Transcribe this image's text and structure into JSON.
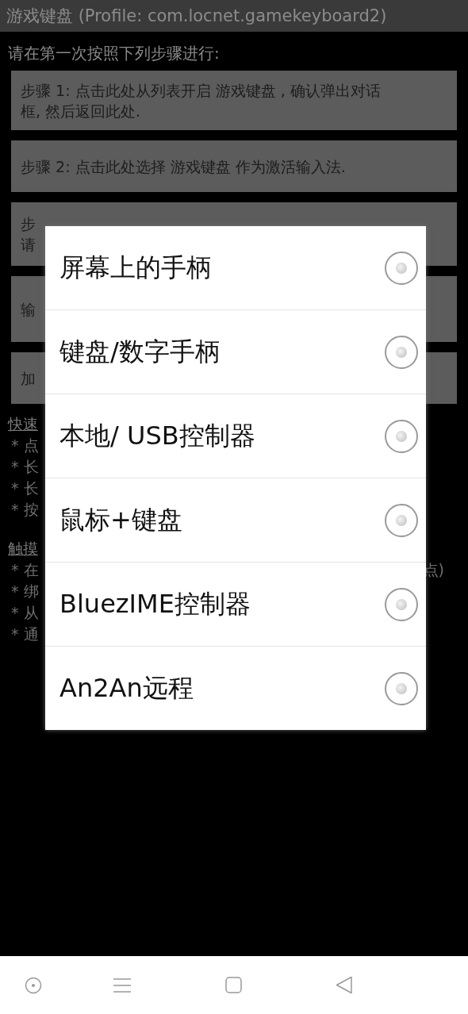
{
  "window": {
    "title": "游戏键盘 (Profile: com.locnet.gamekeyboard2)"
  },
  "intro": "请在第一次按照下列步骤进行:",
  "steps": [
    {
      "lines": [
        "步骤 1: 点击此处从列表开启 游戏键盘 , 确认弹出对话",
        "框, 然后返回此处."
      ]
    },
    {
      "lines": [
        "步骤 2: 点击此处选择 游戏键盘 作为激活输入法."
      ]
    },
    {
      "lines": [
        "步",
        "请"
      ]
    },
    {
      "lines": [
        "输"
      ]
    },
    {
      "lines": [
        "加"
      ]
    }
  ],
  "help": [
    {
      "heading": "快速",
      "lines": [
        {
          "text": "* 点"
        },
        {
          "text": "* 长"
        },
        {
          "text": "* 长"
        },
        {
          "text": "* 按"
        }
      ]
    },
    {
      "heading": "触摸",
      "lines": [
        {
          "text": "* 在",
          "tail": "点)"
        },
        {
          "text": "* 绑"
        },
        {
          "text": "* 从"
        },
        {
          "text": "* 通"
        }
      ]
    }
  ],
  "dialog": {
    "options": [
      {
        "label": "屏幕上的手柄",
        "selected": false
      },
      {
        "label": "键盘/数字手柄",
        "selected": false
      },
      {
        "label": "本地/ USB控制器",
        "selected": false
      },
      {
        "label": "鼠标+键盘",
        "selected": false
      },
      {
        "label": "BluezIME控制器",
        "selected": false
      },
      {
        "label": "An2An远程",
        "selected": false
      }
    ]
  }
}
